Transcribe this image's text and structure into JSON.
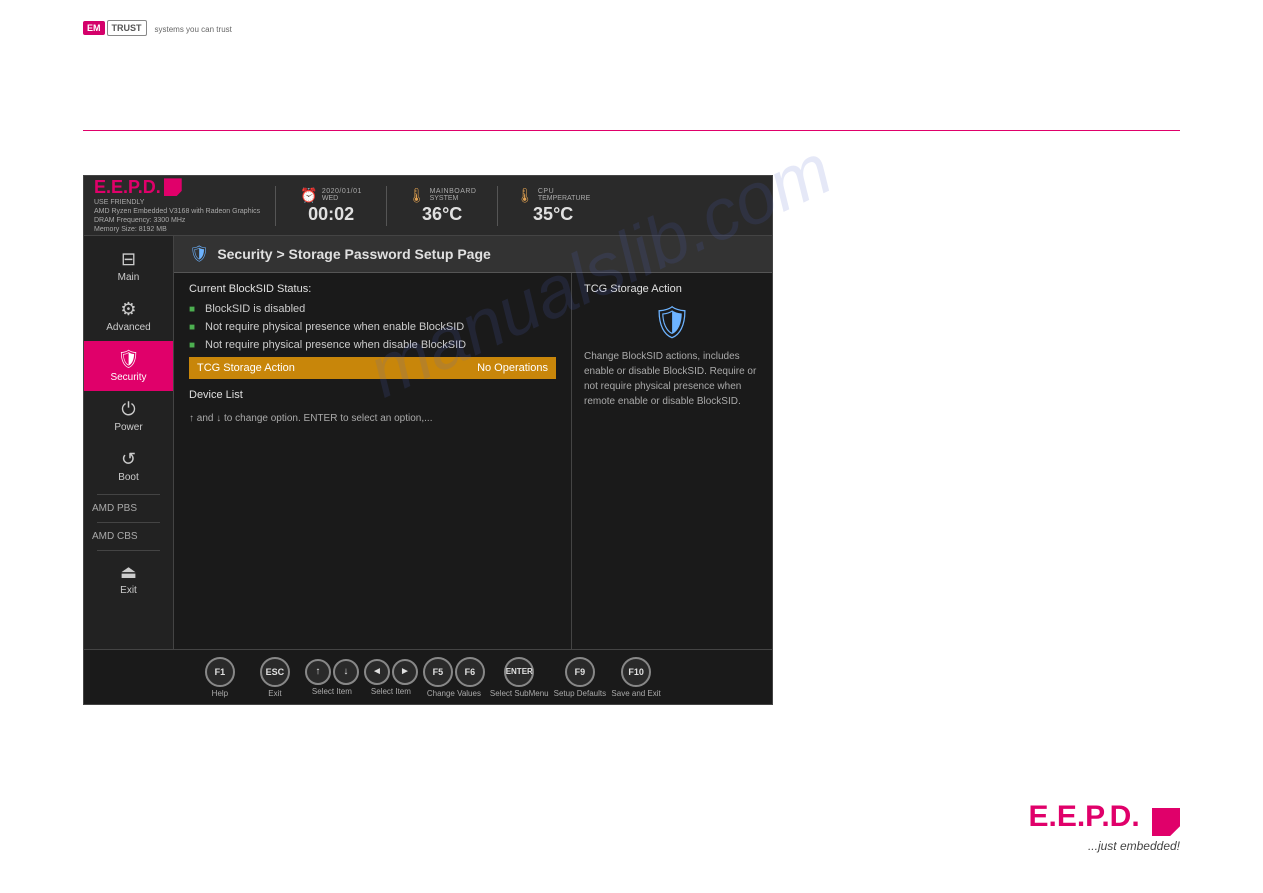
{
  "header": {
    "em_label": "EM",
    "trust_label": "TRUST",
    "tagline": "systems you can trust"
  },
  "bios": {
    "brand": {
      "logo": "E.E.P.D.",
      "subtitle_line1": "USE FRIENDLY",
      "subtitle_line2": "AMD Ryzen Embedded V3168 with Radeon Graphics",
      "subtitle_line3": "DRAM Frequency: 3300 MHz",
      "subtitle_line4": "Memory Size: 8192 MB"
    },
    "clock": {
      "label": "2020/01/01",
      "sublabel": "WED",
      "value": "00:02"
    },
    "mainboard": {
      "label": "MAINBOARD",
      "sublabel": "SYSTEM",
      "value": "36°C"
    },
    "cpu": {
      "label": "CPU",
      "sublabel": "TEMPERATURE",
      "value": "35°C"
    },
    "page_title": "Security > Storage Password Setup Page",
    "sidebar": {
      "items": [
        {
          "id": "main",
          "label": "Main",
          "icon": "⊟"
        },
        {
          "id": "advanced",
          "label": "Advanced",
          "icon": "⚙"
        },
        {
          "id": "security",
          "label": "Security",
          "icon": "🛡",
          "active": true
        },
        {
          "id": "power",
          "label": "Power",
          "icon": "⏻"
        },
        {
          "id": "boot",
          "label": "Boot",
          "icon": "↺"
        },
        {
          "id": "amd-pbs",
          "label": "AMD PBS"
        },
        {
          "id": "amd-cbs",
          "label": "AMD CBS"
        },
        {
          "id": "exit",
          "label": "Exit",
          "icon": "⏏"
        }
      ]
    },
    "content": {
      "section_title": "Current BlockSID Status:",
      "status_items": [
        "BlockSID is disabled",
        "Not require physical presence when enable BlockSID",
        "Not require physical presence when disable BlockSID"
      ],
      "menu_items": [
        {
          "label": "TCG Storage Action",
          "value": "No Operations",
          "selected": true
        }
      ],
      "device_list_label": "Device List",
      "nav_hint": "↑ and ↓ to change option. ENTER to select an option,..."
    },
    "info_panel": {
      "label": "TCG Storage Action",
      "description": "Change BlockSID actions, includes enable or disable BlockSID. Require or not require physical presence when remote enable or disable BlockSID."
    },
    "funckeys": [
      {
        "key": "F1",
        "label": "Help"
      },
      {
        "key": "ESC",
        "label": "Exit"
      },
      {
        "key": "↑↓",
        "label": "Select Item",
        "arrows": true
      },
      {
        "key": "◄►",
        "label": "Select Item",
        "arrows2": true
      },
      {
        "key": "F5",
        "label": "Change Values",
        "pair": "F6"
      },
      {
        "key": "ENTER",
        "label": "Select SubMenu"
      },
      {
        "key": "F9",
        "label": "Setup Defaults"
      },
      {
        "key": "F10",
        "label": "Save and Exit"
      }
    ]
  },
  "bottom_logo": {
    "text": "E.E.P.D.",
    "tagline": "...just embedded!"
  },
  "watermark": "manualslib.com"
}
